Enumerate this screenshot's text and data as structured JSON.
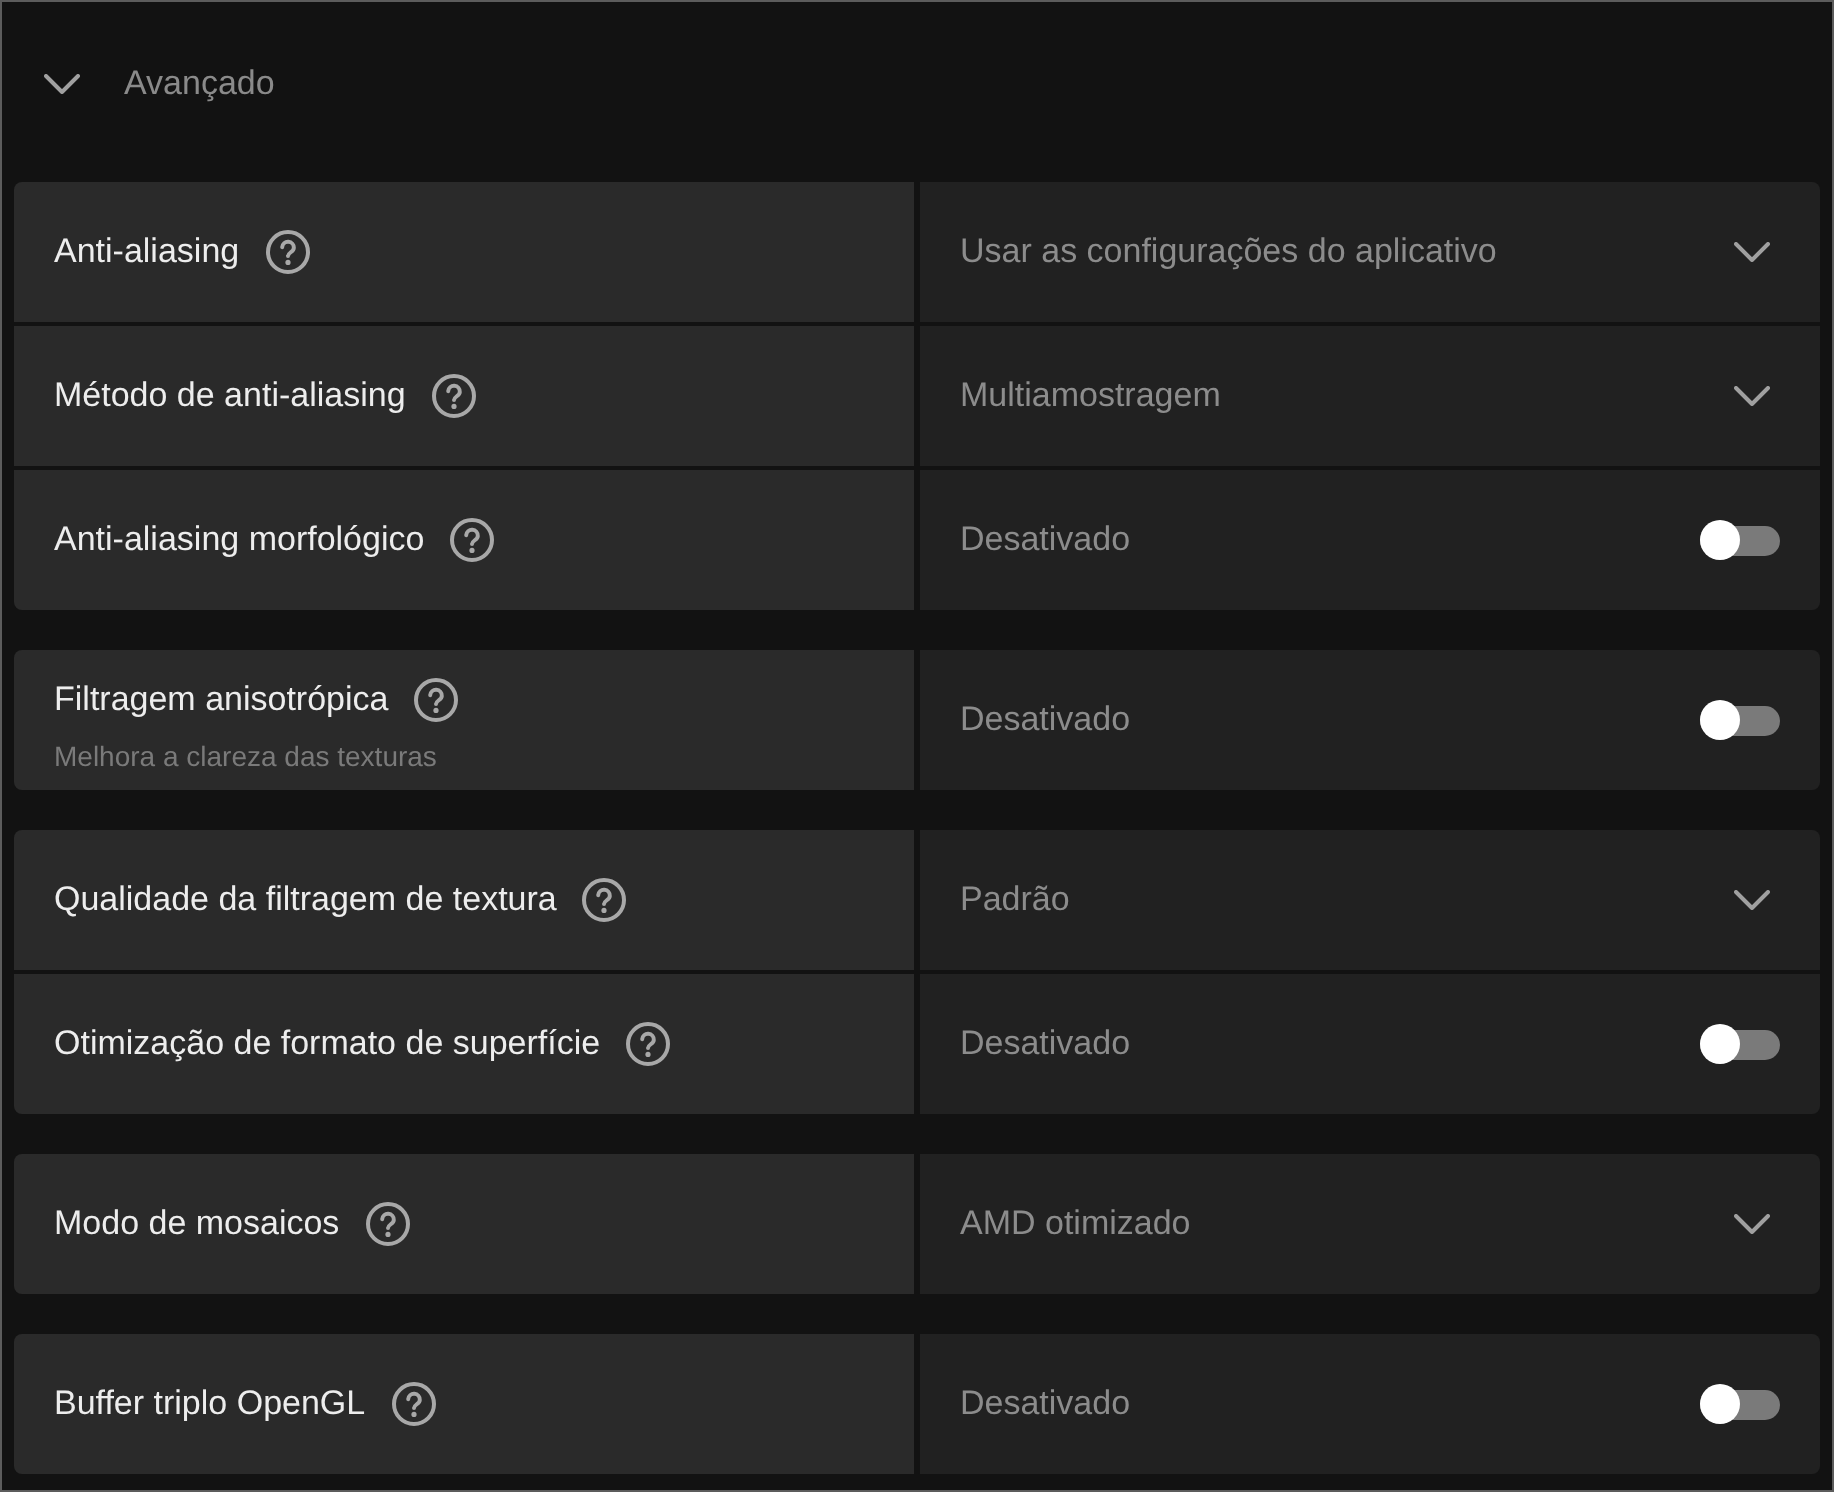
{
  "header": {
    "title": "Avançado",
    "expanded": true
  },
  "groups": [
    {
      "rows": [
        {
          "label": "Anti-aliasing",
          "control": {
            "kind": "dropdown",
            "value": "Usar as configurações do aplicativo"
          }
        },
        {
          "label": "Método de anti-aliasing",
          "control": {
            "kind": "dropdown",
            "value": "Multiamostragem"
          }
        },
        {
          "label": "Anti-aliasing morfológico",
          "control": {
            "kind": "toggle",
            "value": "Desativado",
            "on": false
          }
        }
      ]
    },
    {
      "rows": [
        {
          "label": "Filtragem anisotrópica",
          "description": "Melhora a clareza das texturas",
          "control": {
            "kind": "toggle",
            "value": "Desativado",
            "on": false
          }
        }
      ]
    },
    {
      "rows": [
        {
          "label": "Qualidade da filtragem de textura",
          "control": {
            "kind": "dropdown",
            "value": "Padrão"
          }
        },
        {
          "label": "Otimização de formato de superfície",
          "control": {
            "kind": "toggle",
            "value": "Desativado",
            "on": false
          }
        }
      ]
    },
    {
      "rows": [
        {
          "label": "Modo de mosaicos",
          "control": {
            "kind": "dropdown",
            "value": "AMD otimizado"
          }
        }
      ]
    },
    {
      "rows": [
        {
          "label": "Buffer triplo OpenGL",
          "control": {
            "kind": "toggle",
            "value": "Desativado",
            "on": false
          }
        }
      ]
    }
  ]
}
